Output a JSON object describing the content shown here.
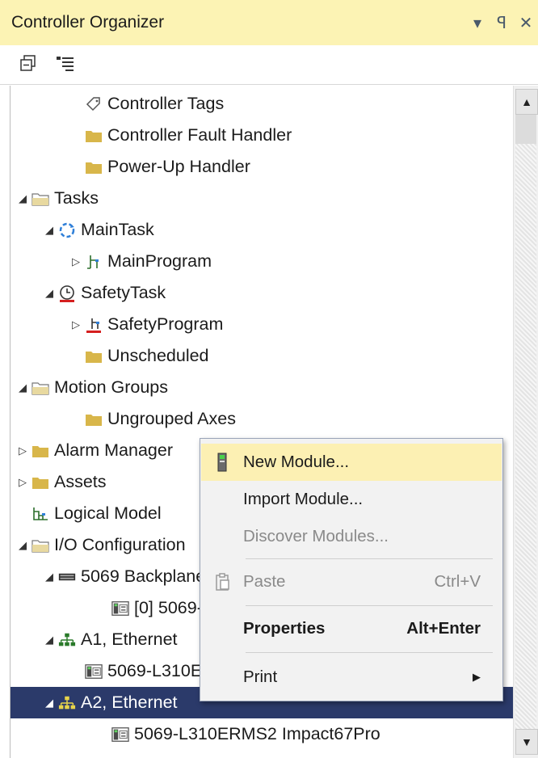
{
  "panel": {
    "title": "Controller Organizer",
    "controls": [
      "▾",
      "ꟼ",
      "✕"
    ]
  },
  "toolbar": {
    "icons": [
      "collapse-all-icon",
      "expand-all-icon"
    ]
  },
  "tree": [
    {
      "label": "Controller Tags",
      "icon": "tag-icon",
      "expander": ""
    },
    {
      "label": "Controller Fault Handler",
      "icon": "folder-icon",
      "expander": ""
    },
    {
      "label": "Power-Up Handler",
      "icon": "folder-icon",
      "expander": ""
    },
    {
      "label": "Tasks",
      "icon": "folder-open-icon",
      "expander": "◢"
    },
    {
      "label": "MainTask",
      "icon": "continuous-task-icon",
      "expander": "◢"
    },
    {
      "label": "MainProgram",
      "icon": "program-icon",
      "expander": "▷"
    },
    {
      "label": "SafetyTask",
      "icon": "periodic-task-icon",
      "expander": "◢"
    },
    {
      "label": "SafetyProgram",
      "icon": "safety-program-icon",
      "expander": "▷"
    },
    {
      "label": "Unscheduled",
      "icon": "folder-icon",
      "expander": ""
    },
    {
      "label": "Motion Groups",
      "icon": "folder-open-icon",
      "expander": "◢"
    },
    {
      "label": "Ungrouped Axes",
      "icon": "folder-icon",
      "expander": ""
    },
    {
      "label": "Alarm Manager",
      "icon": "folder-icon",
      "expander": "▷"
    },
    {
      "label": "Assets",
      "icon": "folder-icon",
      "expander": "▷"
    },
    {
      "label": "Logical Model",
      "icon": "logical-model-icon",
      "expander": ""
    },
    {
      "label": "I/O Configuration",
      "icon": "folder-open-icon",
      "expander": "◢"
    },
    {
      "label": "5069 Backplane",
      "icon": "backplane-icon",
      "expander": "◢"
    },
    {
      "label": "[0] 5069-L310ERMS2 Impact67Pro",
      "icon": "module-icon",
      "expander": ""
    },
    {
      "label": "A1, Ethernet",
      "icon": "ethernet-icon",
      "expander": "◢"
    },
    {
      "label": "5069-L310ERMS2 Impact67Pro",
      "icon": "module-icon",
      "expander": ""
    },
    {
      "label": "A2, Ethernet",
      "icon": "ethernet-icon",
      "expander": "◢"
    },
    {
      "label": "5069-L310ERMS2 Impact67Pro",
      "icon": "module-icon",
      "expander": ""
    }
  ],
  "context_menu": {
    "new_module": "New Module...",
    "import_module": "Import Module...",
    "discover_modules": "Discover Modules...",
    "paste": "Paste",
    "paste_shortcut": "Ctrl+V",
    "properties": "Properties",
    "properties_shortcut": "Alt+Enter",
    "print": "Print",
    "print_arrow": "▶"
  },
  "colors": {
    "title_bg": "#fcf3b4",
    "selection_bg": "#2b3a6a",
    "menu_highlight": "#fcf0b3",
    "folder": "#d8b64a"
  }
}
